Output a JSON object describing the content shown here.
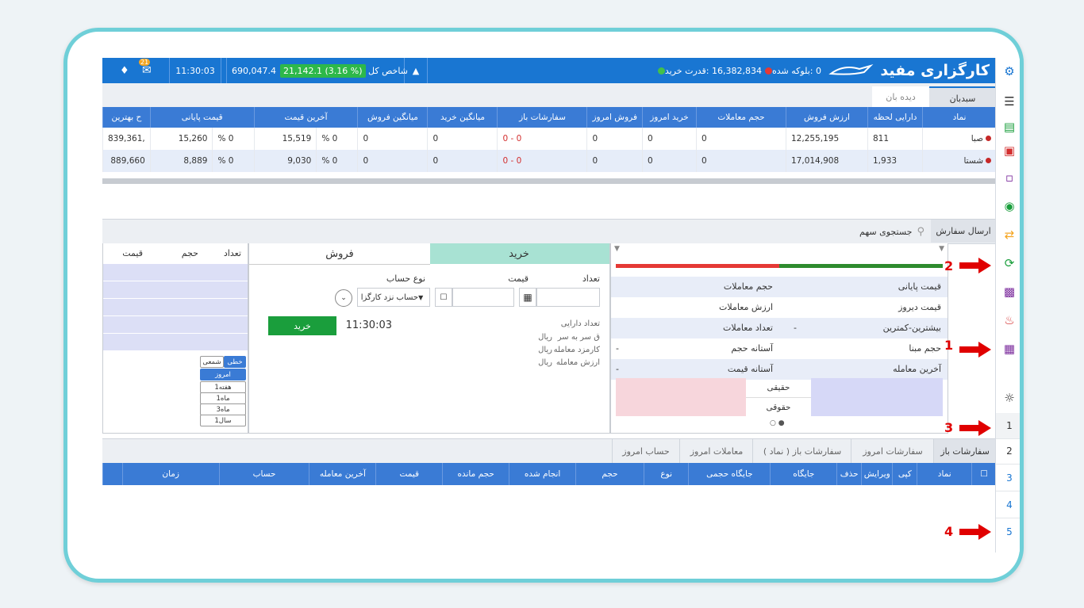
{
  "topbar": {
    "brand": "کارگزاری مفید",
    "purchase_power_label": "قدرت خرید:",
    "purchase_power_value": "16,382,834",
    "blocked_label": "بلوکه شده:",
    "blocked_value": "0",
    "index_label": "شاخص کل",
    "index_change": "21,142.1 (3.16 %)",
    "index_value": "690,047.4",
    "time": "11:30:03",
    "mail_badge": "21"
  },
  "watch_tabs": [
    "سبدبان",
    "دیده بان"
  ],
  "watch_table": {
    "columns": [
      "نماد",
      "دارایی لحظه",
      "ارزش فروش",
      "حجم معاملات",
      "خرید امروز",
      "فروش امروز",
      "سفارشات باز",
      "میانگین خرید",
      "میانگین فروش",
      "آخرین قیمت",
      "",
      "قیمت پایانی",
      "",
      "ح بهترین"
    ],
    "rows": [
      [
        "صبا",
        "811",
        "12,255,195",
        "0",
        "0",
        "0",
        "0 - 0",
        "0",
        "0",
        "0 %",
        "15,519",
        "0 %",
        "15,260",
        ",839,361"
      ],
      [
        "شستا",
        "1,933",
        "17,014,908",
        "0",
        "0",
        "0",
        "0 - 0",
        "0",
        "0",
        "0 %",
        "9,030",
        "0 %",
        "8,889",
        "889,660"
      ]
    ]
  },
  "order_panel": {
    "tab_send": "ارسال سفارش",
    "search_placeholder": "جستجوی سهم",
    "info_rows": [
      {
        "label": "قیمت پایانی",
        "value": "",
        "label2": "حجم معاملات",
        "value2": ""
      },
      {
        "label": "قیمت دیروز",
        "value": "",
        "label2": "ارزش معاملات",
        "value2": ""
      },
      {
        "label": "بیشترین-کمترین",
        "value": "-",
        "label2": "تعداد معاملات",
        "value2": ""
      },
      {
        "label": "حجم مبنا",
        "value": "",
        "label2": "آستانه حجم",
        "value2": "-"
      },
      {
        "label": "آخرین معامله",
        "value": "",
        "label2": "آستانه قیمت",
        "value2": "-"
      }
    ],
    "legal_real": [
      "حقیقی",
      "حقوقی"
    ],
    "buy_tab": "خرید",
    "sell_tab": "فروش",
    "qty_label": "تعداد",
    "price_label": "قیمت",
    "account_type_label": "نوع حساب",
    "account_value": "حساب نزد کارگزا",
    "time": "11:30:03",
    "buy_button": "خرید",
    "summary": [
      "تعداد دارایی",
      "ق سر به سر",
      "کارمزد معامله",
      "ارزش معامله"
    ],
    "currency": "ریال",
    "depth_columns": [
      "تعداد",
      "حجم",
      "قیمت"
    ],
    "chart_modes": [
      "خطی",
      "شمعی"
    ],
    "ranges": [
      "امروز",
      "1هفته",
      "1ماه",
      "3ماه",
      "1سال"
    ]
  },
  "orders": {
    "tabs": [
      "سفارشات باز",
      "سفارشات امروز",
      "سفارشات باز ( نماد )",
      "معاملات امروز",
      "حساب امروز"
    ],
    "columns": [
      "نماد",
      "کپی",
      "ویرایش",
      "حذف",
      "جایگاه",
      "جایگاه حجمی",
      "نوع",
      "حجم",
      "انجام شده",
      "حجم مانده",
      "قیمت",
      "آخرین معامله",
      "حساب",
      "زمان"
    ]
  },
  "sidebar": {
    "numbers": [
      "1",
      "2",
      "3",
      "4",
      "5"
    ]
  },
  "annotations": [
    "1",
    "2",
    "3",
    "4"
  ],
  "colors": {
    "topbar": "#1976d2",
    "header": "#3a7bd5",
    "buy": "#a8e2d3",
    "green": "#1a9e3c",
    "red": "#e00000"
  }
}
